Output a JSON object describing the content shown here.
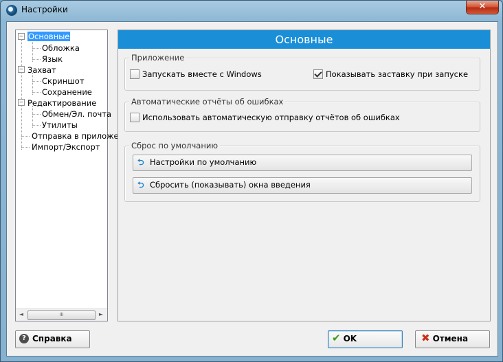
{
  "window": {
    "title": "Настройки",
    "close_glyph": "✕"
  },
  "tree": {
    "nodes": [
      {
        "label": "Основные",
        "selected": true,
        "expander": "−"
      },
      {
        "label": "Обложка"
      },
      {
        "label": "Язык"
      },
      {
        "label": "Захват",
        "expander": "−"
      },
      {
        "label": "Скриншот"
      },
      {
        "label": "Сохранение"
      },
      {
        "label": "Редактирование",
        "expander": "−"
      },
      {
        "label": "Обмен/Эл. почта"
      },
      {
        "label": "Утилиты"
      },
      {
        "label": "Отправка в приложе"
      },
      {
        "label": "Импорт/Экспорт"
      }
    ],
    "scroll_left": "◄",
    "scroll_right": "►",
    "scroll_grip": "III"
  },
  "panel": {
    "header": "Основные",
    "groups": {
      "app": {
        "title": "Приложение",
        "run_with_windows": "Запускать вместе с Windows",
        "show_splash": "Показывать заставку при запуске"
      },
      "errors": {
        "title": "Автоматические отчёты об ошибках",
        "auto_send": "Использовать автоматическую отправку отчётов об ошибках"
      },
      "reset": {
        "title": "Сброс по умолчанию",
        "defaults_button": "Настройки по умолчанию",
        "intro_button": "Сбросить (показывать) окна введения"
      }
    }
  },
  "footer": {
    "help": "Справка",
    "ok": "OK",
    "cancel": "Отмена"
  },
  "colors": {
    "accent": "#1a8fd7",
    "selection": "#3399ff"
  }
}
